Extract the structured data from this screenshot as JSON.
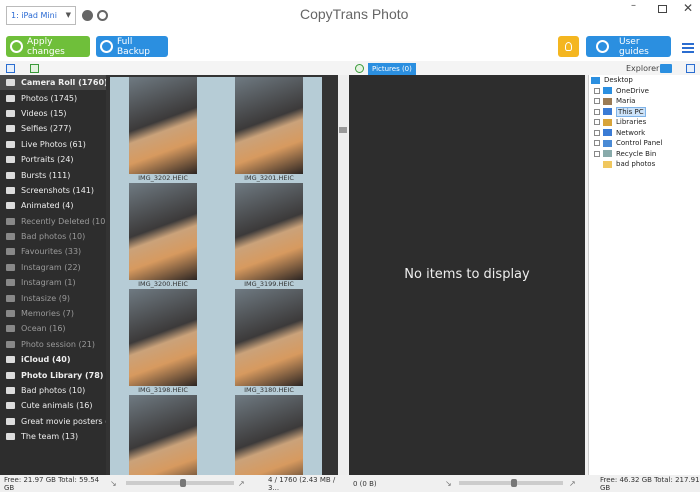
{
  "titlebar": {
    "device": "1: iPad Mini",
    "app_title": "CopyTrans Photo"
  },
  "toolbar": {
    "apply_label": "Apply changes",
    "backup_label": "Full Backup",
    "guides_label": "User guides"
  },
  "subbar": {
    "pictures_tab": "Pictures (0)",
    "explorer_label": "Explorer"
  },
  "sidebar": {
    "items": [
      {
        "label": "Camera Roll (1760)",
        "icon": "camera-icon",
        "state": "active-header"
      },
      {
        "label": "Photos (1745)",
        "icon": "camera-icon",
        "state": "normal"
      },
      {
        "label": "Videos (15)",
        "icon": "video-icon",
        "state": "normal"
      },
      {
        "label": "Selfies (277)",
        "icon": "user-icon",
        "state": "normal"
      },
      {
        "label": "Live Photos (61)",
        "icon": "live-icon",
        "state": "normal"
      },
      {
        "label": "Portraits (24)",
        "icon": "portrait-icon",
        "state": "normal"
      },
      {
        "label": "Bursts (111)",
        "icon": "burst-icon",
        "state": "normal"
      },
      {
        "label": "Screenshots (141)",
        "icon": "screenshot-icon",
        "state": "normal"
      },
      {
        "label": "Animated (4)",
        "icon": "animated-icon",
        "state": "normal"
      },
      {
        "label": "Recently Deleted (10)",
        "icon": "trash-icon",
        "state": "dim"
      },
      {
        "label": "Bad photos (10)",
        "icon": "album-icon",
        "state": "dim"
      },
      {
        "label": "Favourites (33)",
        "icon": "album-icon",
        "state": "dim"
      },
      {
        "label": "Instagram (22)",
        "icon": "album-icon",
        "state": "dim"
      },
      {
        "label": "Instagram (1)",
        "icon": "album-icon",
        "state": "dim"
      },
      {
        "label": "Instasize (9)",
        "icon": "album-icon",
        "state": "dim"
      },
      {
        "label": "Memories (7)",
        "icon": "album-icon",
        "state": "dim"
      },
      {
        "label": "Ocean (16)",
        "icon": "album-icon",
        "state": "dim"
      },
      {
        "label": "Photo session (21)",
        "icon": "album-icon",
        "state": "dim"
      },
      {
        "label": "iCloud (40)",
        "icon": "cloud-icon",
        "state": "header"
      },
      {
        "label": "Photo Library (78)",
        "icon": "camera-icon",
        "state": "header"
      },
      {
        "label": "Bad photos (10)",
        "icon": "album-icon",
        "state": "normal"
      },
      {
        "label": "Cute animals (16)",
        "icon": "album-icon",
        "state": "normal"
      },
      {
        "label": "Great movie posters (15)",
        "icon": "album-icon",
        "state": "normal"
      },
      {
        "label": "The team (13)",
        "icon": "album-icon",
        "state": "normal"
      }
    ]
  },
  "gallery": {
    "thumbs": [
      {
        "caption": "IMG_3202.HEIC"
      },
      {
        "caption": "IMG_3201.HEIC"
      },
      {
        "caption": "IMG_3200.HEIC"
      },
      {
        "caption": "IMG_3199.HEIC"
      },
      {
        "caption": "IMG_3198.HEIC"
      },
      {
        "caption": "IMG_3180.HEIC"
      },
      {
        "caption": ""
      },
      {
        "caption": ""
      }
    ]
  },
  "center": {
    "empty_message": "No items to display"
  },
  "explorer": {
    "items": [
      {
        "label": "Desktop",
        "icon": "desktop-icon"
      },
      {
        "label": "OneDrive",
        "icon": "cloud-icon"
      },
      {
        "label": "Maria",
        "icon": "user-icon"
      },
      {
        "label": "This PC",
        "icon": "computer-icon"
      },
      {
        "label": "Libraries",
        "icon": "library-icon"
      },
      {
        "label": "Network",
        "icon": "network-icon"
      },
      {
        "label": "Control Panel",
        "icon": "control-panel-icon"
      },
      {
        "label": "Recycle Bin",
        "icon": "trash-icon"
      },
      {
        "label": "bad photos",
        "icon": "folder-icon"
      }
    ]
  },
  "status": {
    "device_free": "Free: 21.97 GB Total: 59.54 GB",
    "gallery_count": "4 / 1760 (2.43 MB / 3...",
    "center_count": "0 (0 B)",
    "pc_free": "Free: 46.32 GB Total: 217.91 GB"
  },
  "colors": {
    "green": "#6fbf3a",
    "blue": "#2b8fe0",
    "yellow": "#f4b620",
    "dark": "#2d2d2d"
  }
}
